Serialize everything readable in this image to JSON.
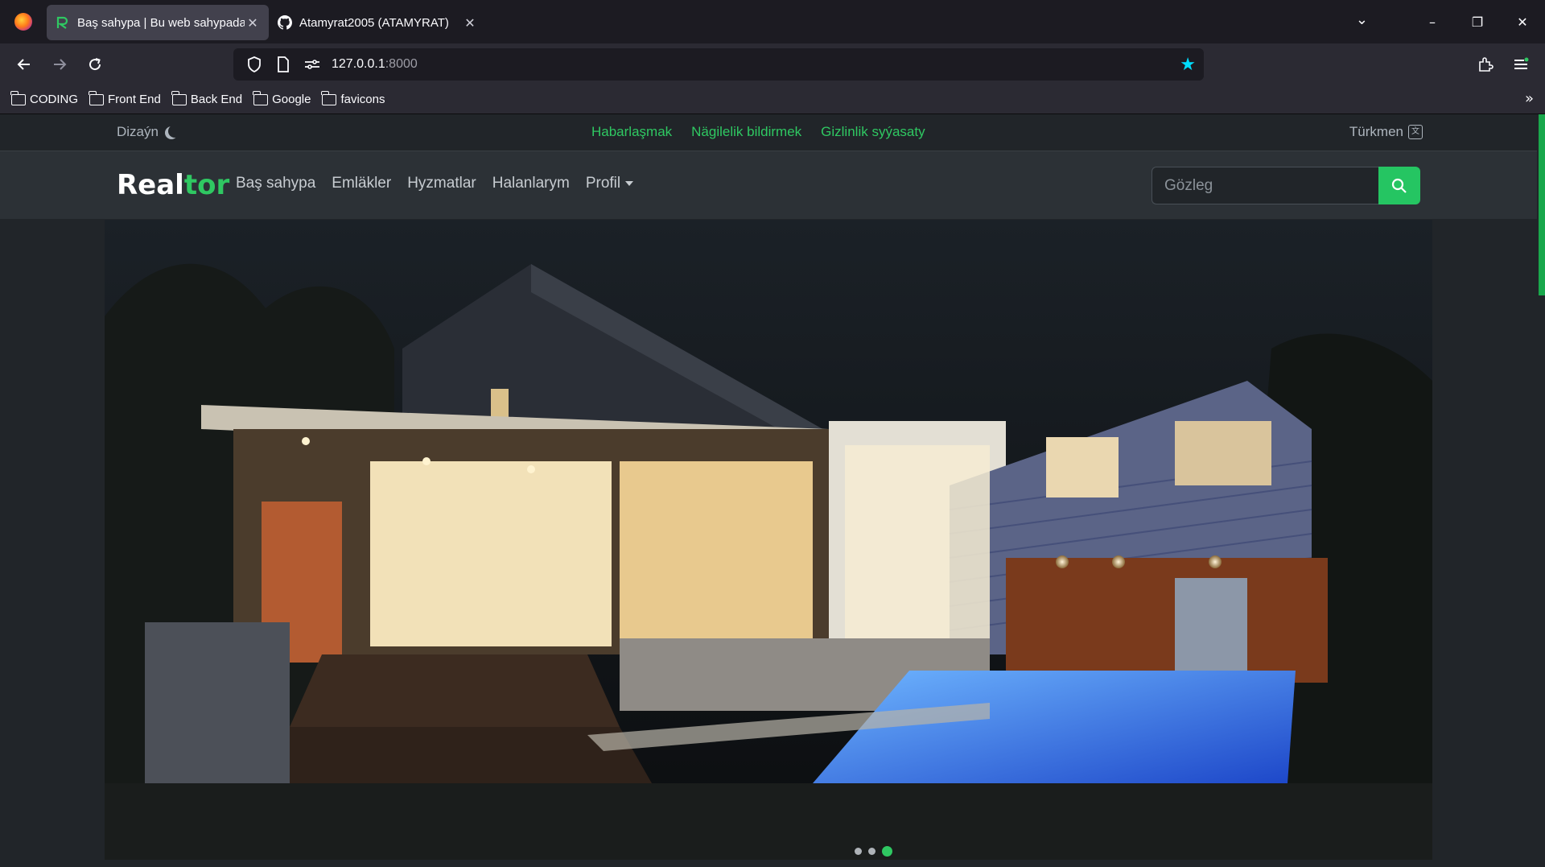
{
  "browser": {
    "tabs": [
      {
        "title": "Baş sahypa | Bu web sahypada t",
        "active": true
      },
      {
        "title": "Atamyrat2005 (ATAMYRAT)",
        "active": false
      }
    ],
    "url_host": "127.0.0.1",
    "url_port": ":8000",
    "bookmarks": [
      "CODING",
      "Front End",
      "Back End",
      "Google",
      "favicons"
    ]
  },
  "site": {
    "topbar": {
      "theme_label": "Dizaýn",
      "links": [
        "Habarlaşmak",
        "Nägilelik bildirmek",
        "Gizlinlik syýasaty"
      ],
      "language": "Türkmen"
    },
    "brand": {
      "part1": "Real",
      "part2": "tor"
    },
    "menu": [
      "Baş sahypa",
      "Emläkler",
      "Hyzmatlar",
      "Halanlarym",
      "Profil"
    ],
    "search": {
      "placeholder": "Gözleg"
    },
    "carousel": {
      "slides": 3,
      "active_index": 2
    }
  },
  "colors": {
    "accent": "#2fc862",
    "bookmark_star": "#00ddff"
  }
}
